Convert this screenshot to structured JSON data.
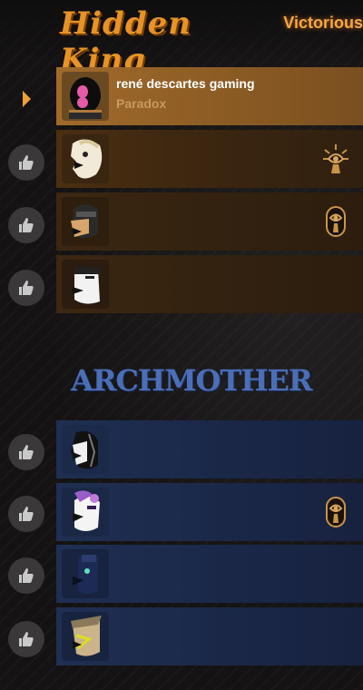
{
  "teams": {
    "hidden_king": {
      "name": "Hidden King",
      "result": "Victorious",
      "color": "#e89326",
      "players": [
        {
          "name": "rené descartes gaming",
          "title": "Paradox",
          "is_self": true,
          "role_icon": null
        },
        {
          "name": "",
          "title": "",
          "is_self": false,
          "role_icon": "sun-eye-icon"
        },
        {
          "name": "",
          "title": "",
          "is_self": false,
          "role_icon": "keyhole-eye-icon"
        },
        {
          "name": "",
          "title": "",
          "is_self": false,
          "role_icon": null
        }
      ]
    },
    "archmother": {
      "name": "Archmother",
      "color": "#4a6fb8",
      "players": [
        {
          "name": "",
          "title": "",
          "role_icon": null
        },
        {
          "name": "",
          "title": "",
          "role_icon": "keyhole-eye-icon"
        },
        {
          "name": "",
          "title": "",
          "role_icon": null
        },
        {
          "name": "",
          "title": "",
          "role_icon": null
        }
      ]
    }
  },
  "icons": {
    "like": "thumbs-up-icon",
    "self_marker": "triangle-right-icon"
  },
  "colors": {
    "accent": "#f0a030",
    "hk_row_self": "#a06a2b",
    "am_row": "#1f2f52"
  }
}
